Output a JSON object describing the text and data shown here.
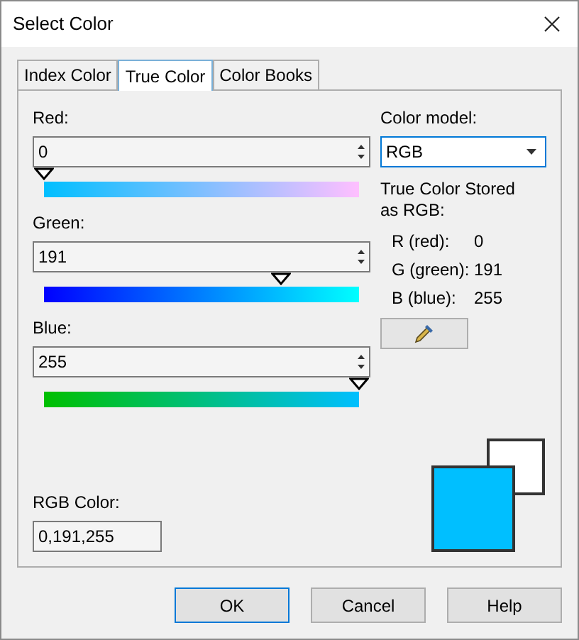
{
  "window": {
    "title": "Select Color"
  },
  "tabs": [
    {
      "label": "Index Color",
      "selected": false
    },
    {
      "label": "True Color",
      "selected": true
    },
    {
      "label": "Color Books",
      "selected": false
    }
  ],
  "channels": [
    {
      "label": "Red:",
      "value": "0",
      "level": 0
    },
    {
      "label": "Green:",
      "value": "191",
      "level": 0.75
    },
    {
      "label": "Blue:",
      "value": "255",
      "level": 1
    }
  ],
  "color_model": {
    "label": "Color model:",
    "value": "RGB"
  },
  "stored": {
    "heading": "True Color Stored as RGB:",
    "rows": [
      {
        "label": "R (red):",
        "value": "0"
      },
      {
        "label": "G (green):",
        "value": "191"
      },
      {
        "label": "B (blue):",
        "value": "255"
      }
    ]
  },
  "rgb_color": {
    "label": "RGB Color:",
    "value": "0,191,255"
  },
  "swatches": [
    {
      "kind": "original",
      "color": "#ffffff"
    },
    {
      "kind": "current",
      "color": "#00bfff"
    }
  ],
  "buttons": [
    {
      "label": "OK",
      "default": true
    },
    {
      "label": "Cancel",
      "default": false
    },
    {
      "label": "Help",
      "default": false
    }
  ]
}
